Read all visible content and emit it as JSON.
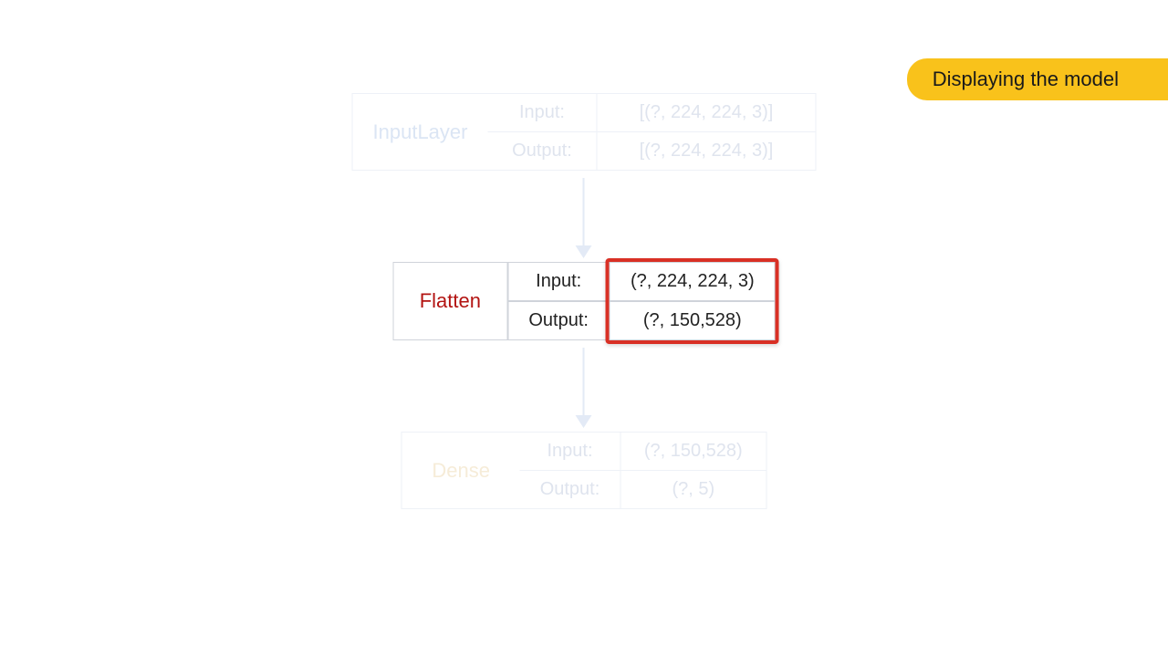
{
  "badge": {
    "label": "Displaying the model"
  },
  "layers": [
    {
      "name": "InputLayer",
      "input_label": "Input:",
      "output_label": "Output:",
      "input_shape": "[(?, 224, 224, 3)]",
      "output_shape": "[(?, 224, 224, 3)]"
    },
    {
      "name": "Flatten",
      "input_label": "Input:",
      "output_label": "Output:",
      "input_shape": "(?, 224, 224, 3)",
      "output_shape": "(?, 150,528)"
    },
    {
      "name": "Dense",
      "input_label": "Input:",
      "output_label": "Output:",
      "input_shape": "(?, 150,528)",
      "output_shape": "(?, 5)"
    }
  ],
  "highlight": {
    "layer_index": 1,
    "target": "shape-column"
  }
}
